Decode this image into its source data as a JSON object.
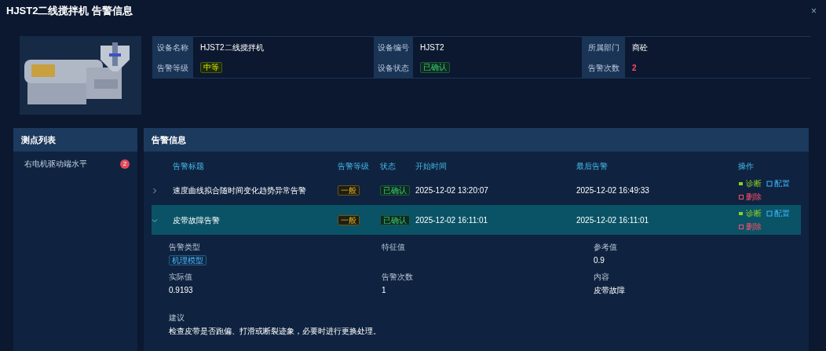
{
  "window": {
    "title": "HJST2二线搅拌机 告警信息",
    "close": "×"
  },
  "device": {
    "fields": [
      {
        "label": "设备名称",
        "value": "HJST2二线搅拌机",
        "kind": "text"
      },
      {
        "label": "设备编号",
        "value": "HJST2",
        "kind": "text"
      },
      {
        "label": "所属部门",
        "value": "商砼",
        "kind": "text"
      },
      {
        "label": "告警等级",
        "value": "中等",
        "kind": "level"
      },
      {
        "label": "设备状态",
        "value": "已确认",
        "kind": "status"
      },
      {
        "label": "告警次数",
        "value": "2",
        "kind": "count"
      }
    ]
  },
  "points": {
    "title": "测点列表",
    "items": [
      {
        "label": "右电机驱动端水平",
        "count": "2"
      }
    ]
  },
  "alerts": {
    "title": "告警信息",
    "columns": [
      "告警标题",
      "告警等级",
      "状态",
      "开始时间",
      "最后告警",
      "操作"
    ],
    "rows": [
      {
        "expanded": false,
        "title": "速度曲线拟合随时间变化趋势异常告警",
        "level": "一般",
        "status": "已确认",
        "start": "2025-12-02 13:20:07",
        "last": "2025-12-02 16:49:33",
        "actions": [
          {
            "label": "诊断",
            "kind": "diagnose"
          },
          {
            "label": "配置",
            "kind": "config"
          },
          {
            "label": "删除",
            "kind": "delete"
          }
        ]
      },
      {
        "expanded": true,
        "title": "皮带故障告警",
        "level": "一般",
        "status": "已确认",
        "start": "2025-12-02 16:11:01",
        "last": "2025-12-02 16:11:01",
        "actions": [
          {
            "label": "诊断",
            "kind": "diagnose"
          },
          {
            "label": "配置",
            "kind": "config"
          },
          {
            "label": "删除",
            "kind": "delete"
          }
        ],
        "detail": {
          "fields": [
            {
              "label": "告警类型",
              "value": "机理模型",
              "kind": "tag"
            },
            {
              "label": "特征值"
            },
            {
              "label": "参考值",
              "value": "0.9",
              "kind": "text"
            },
            {
              "label": "实际值",
              "value": "0.9193",
              "kind": "text"
            },
            {
              "label": "告警次数",
              "value": "1",
              "kind": "text"
            },
            {
              "label": "内容",
              "value": "皮带故障",
              "kind": "text"
            }
          ],
          "suggestion": {
            "label": "建议",
            "text": "检查皮带是否跑偏、打滑或断裂迹象，必要时进行更换处理。"
          }
        }
      }
    ]
  }
}
